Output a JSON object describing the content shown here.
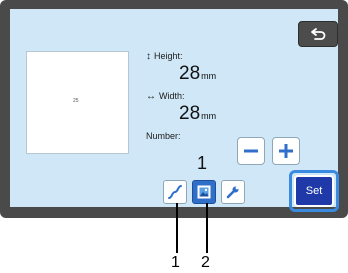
{
  "preview": {
    "label": "25"
  },
  "height": {
    "label": "Height:",
    "value": "28",
    "unit": "mm"
  },
  "width": {
    "label": "Width:",
    "value": "28",
    "unit": "mm"
  },
  "number": {
    "label": "Number:",
    "value": "1"
  },
  "set_button": {
    "label": "Set"
  },
  "callouts": [
    "1",
    "2"
  ],
  "icons": {
    "back": "back-arrow-icon",
    "height": "vertical-arrow-icon",
    "width": "horizontal-arrow-icon",
    "minus": "minus-icon",
    "plus": "plus-icon",
    "curve": "curve-icon",
    "image": "image-icon",
    "wrench": "wrench-icon"
  },
  "colors": {
    "screen": "#cfe7f6",
    "bezel": "#4a4a4a",
    "set_button": "#1f3aa8",
    "highlight": "#3a8be0",
    "active_tool": "#2f6fc9"
  }
}
